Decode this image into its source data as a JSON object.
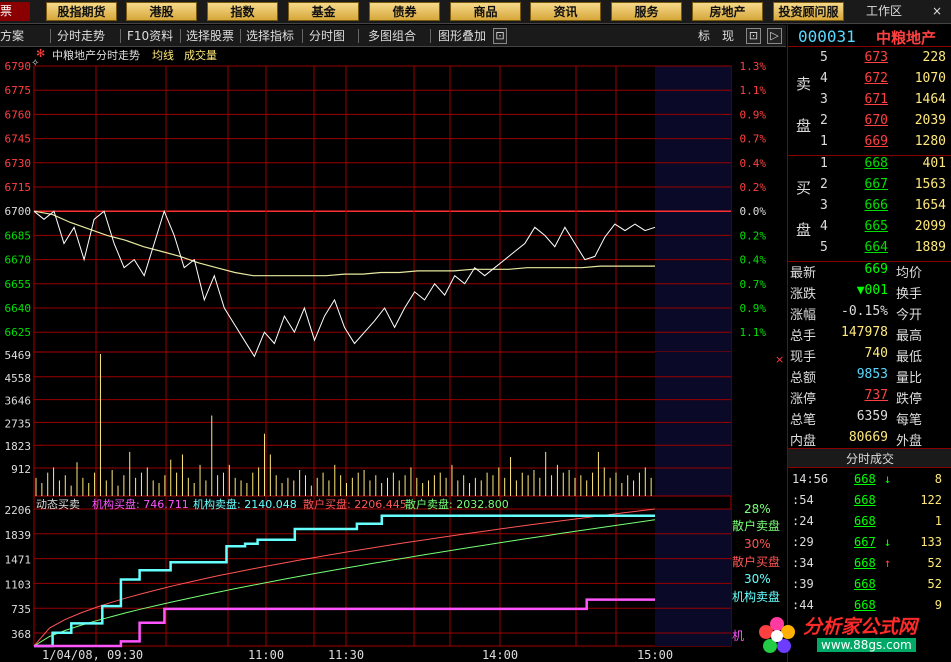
{
  "menu": {
    "tab0": "票",
    "items": [
      "股指期货",
      "港股",
      "指数",
      "基金",
      "债券",
      "商品",
      "资讯",
      "服务",
      "房地产",
      "投资顾问服"
    ],
    "workarea": "工作区",
    "close": "×"
  },
  "toolbar": {
    "items": [
      "方案",
      "分时走势",
      "F10资料",
      "选择股票",
      "选择指标",
      "分时图",
      "多图组合",
      "图形叠加"
    ],
    "right_buttons": [
      "标",
      "现",
      "⊡",
      "▷"
    ]
  },
  "chart_data": [
    {
      "type": "line",
      "title": "中粮地产分时走势",
      "legend": [
        "均线",
        "成交量"
      ],
      "y_ticks_left": [
        "6790",
        "6775",
        "6760",
        "6745",
        "6730",
        "6715",
        "6700",
        "6685",
        "6670",
        "6655",
        "6640",
        "6625"
      ],
      "y_ticks_right": [
        "1.3%",
        "1.1%",
        "0.9%",
        "0.7%",
        "0.4%",
        "0.2%",
        "0.0%",
        "0.2%",
        "0.4%",
        "0.7%",
        "0.9%",
        "1.1%"
      ],
      "x_ticks": [
        "1/04/08, 09:30",
        "11:00",
        "11:30",
        "14:00",
        "15:00"
      ],
      "series": [
        {
          "name": "价格",
          "color": "#ffffff",
          "values": [
            6700,
            6695,
            6700,
            6680,
            6690,
            6670,
            6695,
            6700,
            6680,
            6665,
            6670,
            6660,
            6680,
            6700,
            6685,
            6665,
            6670,
            6645,
            6660,
            6640,
            6630,
            6620,
            6610,
            6625,
            6618,
            6635,
            6625,
            6640,
            6620,
            6635,
            6645,
            6628,
            6618,
            6625,
            6632,
            6640,
            6628,
            6640,
            6650,
            6645,
            6655,
            6648,
            6660,
            6655,
            6665,
            6660,
            6665,
            6670,
            6675,
            6680,
            6690,
            6685,
            6678,
            6690,
            6680,
            6670,
            6672,
            6684,
            6692,
            6688,
            6692,
            6688,
            6690
          ]
        },
        {
          "name": "均线",
          "color": "#e8e8a0",
          "values": [
            6700,
            6698,
            6693,
            6689,
            6685,
            6682,
            6678,
            6675,
            6672,
            6668,
            6665,
            6662,
            6660,
            6660,
            6660,
            6660,
            6660,
            6661,
            6661,
            6662,
            6662,
            6663,
            6663,
            6663,
            6664,
            6664,
            6664,
            6665,
            6665,
            6665,
            6665,
            6666,
            6666,
            6666,
            6666
          ]
        }
      ]
    },
    {
      "type": "bar",
      "title": "成交量",
      "y_ticks": [
        "5469",
        "4558",
        "3646",
        "2735",
        "1823",
        "912"
      ],
      "ylim": [
        0,
        5469
      ],
      "values": [
        700,
        500,
        900,
        1100,
        600,
        800,
        400,
        1300,
        700,
        500,
        900,
        5469,
        600,
        1000,
        400,
        800,
        1700,
        700,
        900,
        1100,
        600,
        500,
        800,
        1400,
        900,
        1600,
        700,
        500,
        1200,
        600,
        3100,
        800,
        900,
        1200,
        700,
        600,
        500,
        900,
        1100,
        2400,
        1600,
        800,
        500,
        700,
        600,
        1000,
        800,
        400,
        700,
        900,
        600,
        1200,
        800,
        500,
        700,
        900,
        1000,
        600,
        800,
        500,
        700,
        900,
        600,
        800,
        1100,
        700,
        500,
        600,
        800,
        900,
        700,
        1200,
        600,
        800,
        500,
        700,
        600,
        900,
        800,
        1100,
        700,
        1500,
        600,
        900,
        800,
        1000,
        700,
        1700,
        800,
        1200,
        900,
        1000,
        700,
        800,
        600,
        900,
        1700,
        1100,
        700,
        900,
        500,
        800,
        600,
        900,
        1100,
        700
      ]
    },
    {
      "type": "line",
      "title": "动态买卖",
      "legend": [
        {
          "name": "机构买盘",
          "value": "746.711",
          "color": "#ff55ff"
        },
        {
          "name": "机构卖盘",
          "value": "2140.048",
          "color": "#66ffff"
        },
        {
          "name": "散户买盘",
          "value": "2206.445",
          "color": "#ff5555"
        },
        {
          "name": "散户卖盘",
          "value": "2032.800",
          "color": "#77ff77"
        }
      ],
      "y_ticks": [
        "2206",
        "1839",
        "1471",
        "1103",
        "735",
        "368"
      ],
      "ylim": [
        0,
        2206
      ],
      "right_labels": [
        {
          "pct": "28%",
          "name": "散户卖盘"
        },
        {
          "pct": "30%",
          "name": "散户买盘"
        },
        {
          "pct": "30%",
          "name": "机构卖盘"
        },
        {
          "name": "机"
        }
      ]
    }
  ],
  "stock": {
    "code": "000031",
    "name": "中粮地产"
  },
  "orderbook": {
    "sell_label": [
      "卖",
      "盘"
    ],
    "buy_label": [
      "买",
      "盘"
    ],
    "sell": [
      {
        "level": "5",
        "price": "673",
        "vol": "228"
      },
      {
        "level": "4",
        "price": "672",
        "vol": "1070"
      },
      {
        "level": "3",
        "price": "671",
        "vol": "1464"
      },
      {
        "level": "2",
        "price": "670",
        "vol": "2039"
      },
      {
        "level": "1",
        "price": "669",
        "vol": "1280"
      }
    ],
    "buy": [
      {
        "level": "1",
        "price": "668",
        "vol": "401"
      },
      {
        "level": "2",
        "price": "667",
        "vol": "1563"
      },
      {
        "level": "3",
        "price": "666",
        "vol": "1654"
      },
      {
        "level": "4",
        "price": "665",
        "vol": "2099"
      },
      {
        "level": "5",
        "price": "664",
        "vol": "1889"
      }
    ]
  },
  "quote": [
    {
      "k1": "最新",
      "v1": "669",
      "k2": "均价"
    },
    {
      "k1": "涨跌",
      "v1": "▼001",
      "k2": "换手"
    },
    {
      "k1": "涨幅",
      "v1": "-0.15%",
      "k2": "今开"
    },
    {
      "k1": "总手",
      "v1": "147978",
      "k2": "最高"
    },
    {
      "k1": "现手",
      "v1": "740",
      "k2": "最低"
    },
    {
      "k1": "总额",
      "v1": "9853",
      "k2": "量比"
    },
    {
      "k1": "涨停",
      "v1": "737",
      "k2": "跌停"
    },
    {
      "k1": "总笔",
      "v1": "6359",
      "k2": "每笔"
    },
    {
      "k1": "内盘",
      "v1": "80669",
      "k2": "外盘"
    }
  ],
  "trades": {
    "title": "分时成交",
    "rows": [
      {
        "t": "14:56",
        "p": "668",
        "arrow": "down",
        "v": "8"
      },
      {
        "t": ":54",
        "p": "668",
        "arrow": "",
        "v": "122"
      },
      {
        "t": ":24",
        "p": "668",
        "arrow": "",
        "v": "1"
      },
      {
        "t": ":29",
        "p": "667",
        "arrow": "down",
        "v": "133"
      },
      {
        "t": ":34",
        "p": "668",
        "arrow": "up",
        "v": "52"
      },
      {
        "t": ":39",
        "p": "668",
        "arrow": "",
        "v": "52"
      },
      {
        "t": ":44",
        "p": "668",
        "arrow": "",
        "v": "9"
      }
    ]
  },
  "watermark": {
    "text": "分析家公式网",
    "url": "www.88gs.com"
  }
}
